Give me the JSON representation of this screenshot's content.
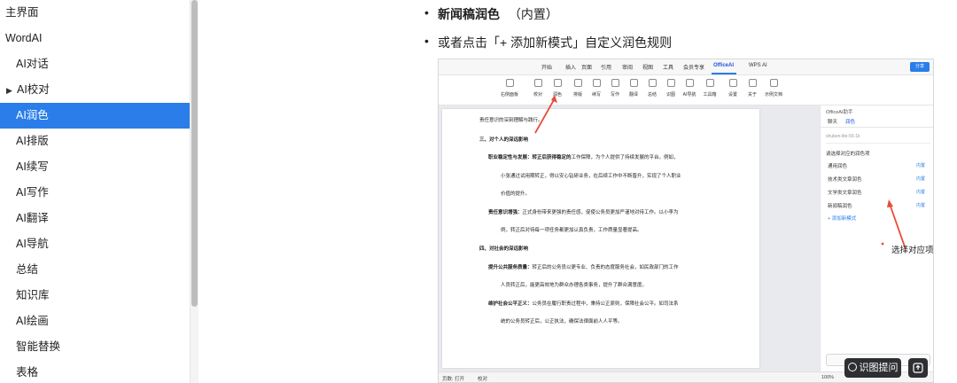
{
  "sidebar": {
    "items": [
      {
        "label": "主界面",
        "level": 0
      },
      {
        "label": "WordAI",
        "level": 0
      },
      {
        "label": "AI对话",
        "level": 1
      },
      {
        "label": "AI校对",
        "level": 1,
        "expandable": true
      },
      {
        "label": "AI润色",
        "level": 1,
        "active": true
      },
      {
        "label": "AI排版",
        "level": 1
      },
      {
        "label": "AI续写",
        "level": 1
      },
      {
        "label": "AI写作",
        "level": 1
      },
      {
        "label": "AI翻译",
        "level": 1
      },
      {
        "label": "AI导航",
        "level": 1
      },
      {
        "label": "总结",
        "level": 1
      },
      {
        "label": "知识库",
        "level": 1
      },
      {
        "label": "AI绘画",
        "level": 1
      },
      {
        "label": "智能替换",
        "level": 1
      },
      {
        "label": "表格",
        "level": 1
      }
    ]
  },
  "content": {
    "bullet1_bold": "新闻稿润色",
    "bullet1_rest": "（内置）",
    "bullet2": "或者点击「+ 添加新模式」自定义润色规则"
  },
  "screenshot": {
    "menus": [
      "开始",
      "插入",
      "页面",
      "引用",
      "审阅",
      "视图",
      "工具",
      "会员专享",
      "OfficeAI",
      "WPS AI"
    ],
    "share_label": "分享",
    "ribbon": [
      "右侧面板",
      "校对",
      "润色",
      "排版",
      "续写",
      "写作",
      "翻译",
      "总结",
      "识图",
      "AI导航",
      "工具箱",
      "设置",
      "关于",
      "示例文档"
    ],
    "doc_lines": [
      {
        "text": "责任意识的深刻理解与践行。",
        "bold": ""
      },
      {
        "text": "三、对个人的深远影响",
        "bold": "all"
      },
      {
        "text": "工作保障，为个人提供了持续发展的平台。例如，",
        "bold": "职业稳定性与发展：转正后获得稳定的"
      },
      {
        "text": "小张通过试用期转正，得以安心钻研业务，在后续工作中不断晋升，实现了个人职业",
        "bold": ""
      },
      {
        "text": "价值的提升。",
        "bold": ""
      },
      {
        "text": "正式身份带来更强的责任感，促使公务员更加严谨地对待工作。以小李为",
        "bold": "责任意识增强："
      },
      {
        "text": "例，转正后对待每一项任务都更加认真负责，工作质量显著提高。",
        "bold": ""
      },
      {
        "text": "四、对社会的深远影响",
        "bold": "all"
      },
      {
        "text": "转正后的公务员以更专业、负责的态度服务社会，如民政部门的工作",
        "bold": "提升公共服务质量："
      },
      {
        "text": "人员转正后，能更高效地为群众办理各类事务，提升了群众满意度。",
        "bold": ""
      },
      {
        "text": "公务员在履行职责过程中，秉持公正原则，保障社会公平。如司法系",
        "bold": "维护社会公平正义："
      },
      {
        "text": "统的公务员转正后，公正执法，确保法律面前人人平等。",
        "bold": ""
      }
    ],
    "panel": {
      "title": "OfficeAI助手",
      "tabs": [
        "聊天",
        "润色"
      ],
      "user": "shuben-lite-55-1k",
      "question": "请选择对应的润色项",
      "items": [
        {
          "label": "通用润色",
          "tag": "内置"
        },
        {
          "label": "技术类文章润色",
          "tag": "内置"
        },
        {
          "label": "文学类文章润色",
          "tag": "内置"
        },
        {
          "label": "新闻稿润色",
          "tag": "内置"
        }
      ],
      "add_label": "+ 添加新模式"
    },
    "annotation": "选择对应项",
    "status_left": "页数: 打开",
    "status_mid": "校对",
    "zoom": "100%"
  },
  "floating": {
    "ocr_label": "识图提问"
  },
  "colors": {
    "accent": "#2b7de9",
    "arrow": "#e74c3c"
  }
}
